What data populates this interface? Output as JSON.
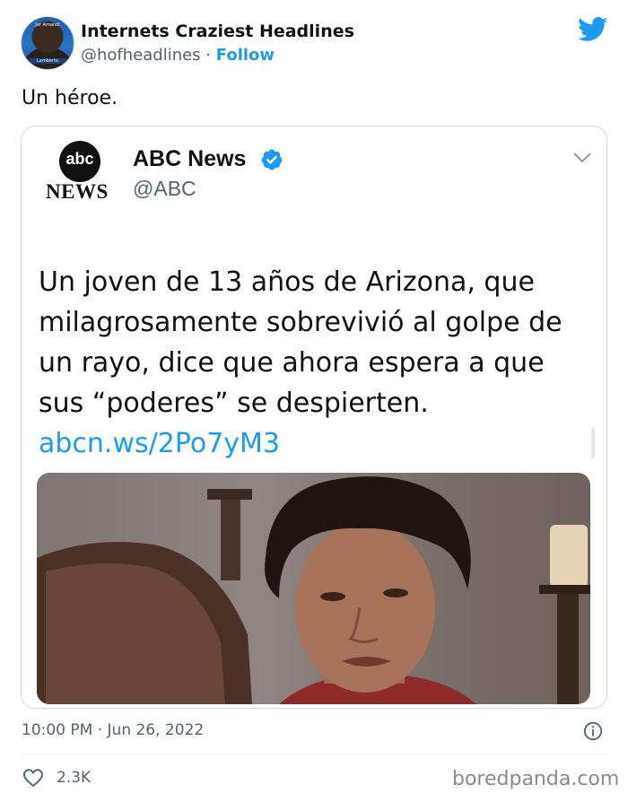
{
  "header": {
    "account_name": "Internets Craziest Headlines",
    "handle": "@hofheadlines",
    "separator": "·",
    "follow_label": "Follow",
    "avatar_text_top": "Jer Amandi",
    "avatar_text_bottom": "Lamberto"
  },
  "tweet": {
    "text": "Un héroe."
  },
  "quoted": {
    "logo_text": "abc",
    "logo_news_text": "NEWS",
    "name": "ABC News",
    "handle": "@ABC",
    "body": "Un joven de 13 años de Arizona, que milagrosamente sobrevivió al golpe de un rayo, dice que ahora espera a que sus “poderes” se despierten.",
    "link": "abcn.ws/2Po7yM3"
  },
  "meta": {
    "timestamp": "10:00 PM · Jun 26, 2022",
    "likes": "2.3K"
  },
  "watermark": "boredpanda.com",
  "colors": {
    "accent": "#1d9bf0",
    "text_primary": "#0f1419",
    "text_secondary": "#536471",
    "border": "#cfd9de"
  },
  "icons": {
    "brand": "twitter-bird-icon",
    "verified": "verified-badge-icon",
    "menu": "chevron-down-icon",
    "info": "info-icon",
    "like": "heart-icon"
  }
}
